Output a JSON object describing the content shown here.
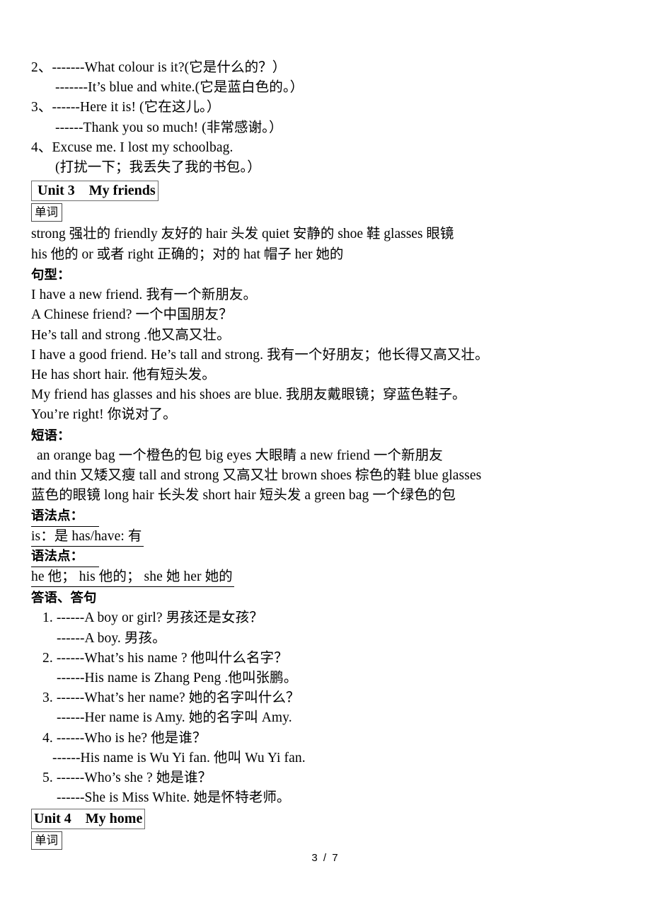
{
  "document": {
    "footer": "3  /  7"
  },
  "top_dialogues": [
    {
      "num": "2、",
      "text": "-------What colour is it?(它是什么的？）"
    },
    {
      "num": "",
      "text": "-------It’s blue and white.(它是蓝白色的。）"
    },
    {
      "num": "3、",
      "text": "------Here it is! (它在这儿。）"
    },
    {
      "num": "",
      "text": "------Thank you so much! (非常感谢。）"
    },
    {
      "num": "4、",
      "text": "Excuse me. I lost my schoolbag."
    },
    {
      "num": "",
      "text": "(打扰一下；我丢失了我的书包。）"
    }
  ],
  "unit3": {
    "heading": " Unit 3    My friends",
    "words_label": "单词",
    "words_lines": [
      "strong  强壮的    friendly  友好的    hair  头发    quiet  安静的    shoe 鞋  glasses 眼镜",
      "his  他的    or  或者    right 正确的；对的     hat  帽子    her  她的"
    ],
    "patterns_label": "句型：",
    "patterns": [
      "I have a new friend.  我有一个新朋友。",
      "A Chinese friend?  一个中国朋友？",
      "He’s tall and strong .他又高又壮。",
      "I have a good friend.    He’s tall and strong.  我有一个好朋友；他长得又高又壮。",
      "He has short hair.  他有短头发。",
      "My friend has glasses and his shoes are blue.  我朋友戴眼镜；穿蓝色鞋子。",
      "You’re right!  你说对了。"
    ],
    "phrases_label": "短语：",
    "phrases_lines": [
      " an orange bag  一个橙色的包            big eyes 大眼睛          a new friend  一个新朋友",
      "and thin  又矮又瘦        tall and strong   又高又壮              brown shoes    棕色的鞋      blue glasses",
      "蓝色的眼镜  long hair  长头发    short hair  短头发   a green bag  一个绿色的包"
    ],
    "grammar": [
      {
        "label": "语法点：",
        "content": "is：是    has/have: 有        "
      },
      {
        "label": "语法点：",
        "content": "he  他；  his  他的；  she  她   her  她的"
      }
    ],
    "answers_label": "答语、答句",
    "answers": [
      {
        "num": "1.",
        "q": "------A boy or girl?    男孩还是女孩？",
        "a": "------A boy.  男孩。"
      },
      {
        "num": "2.",
        "q": "------What’s his name ?  他叫什么名字？",
        "a": "------His name is Zhang Peng .他叫张鹏。"
      },
      {
        "num": "3.",
        "q": "------What’s her name?  她的名字叫什么？",
        "a": "------Her name is Amy.  她的名字叫 Amy."
      },
      {
        "num": "4.",
        "q": "------Who is he?  他是谁？",
        "a": "------His name is Wu Yi fan.  他叫  Wu Yi fan."
      },
      {
        "num": "5.",
        "q": "------Who’s she ?  她是谁？",
        "a": "------She is Miss White.  她是怀特老师。"
      }
    ]
  },
  "unit4": {
    "heading": "Unit 4    My home",
    "words_label": "单词"
  }
}
